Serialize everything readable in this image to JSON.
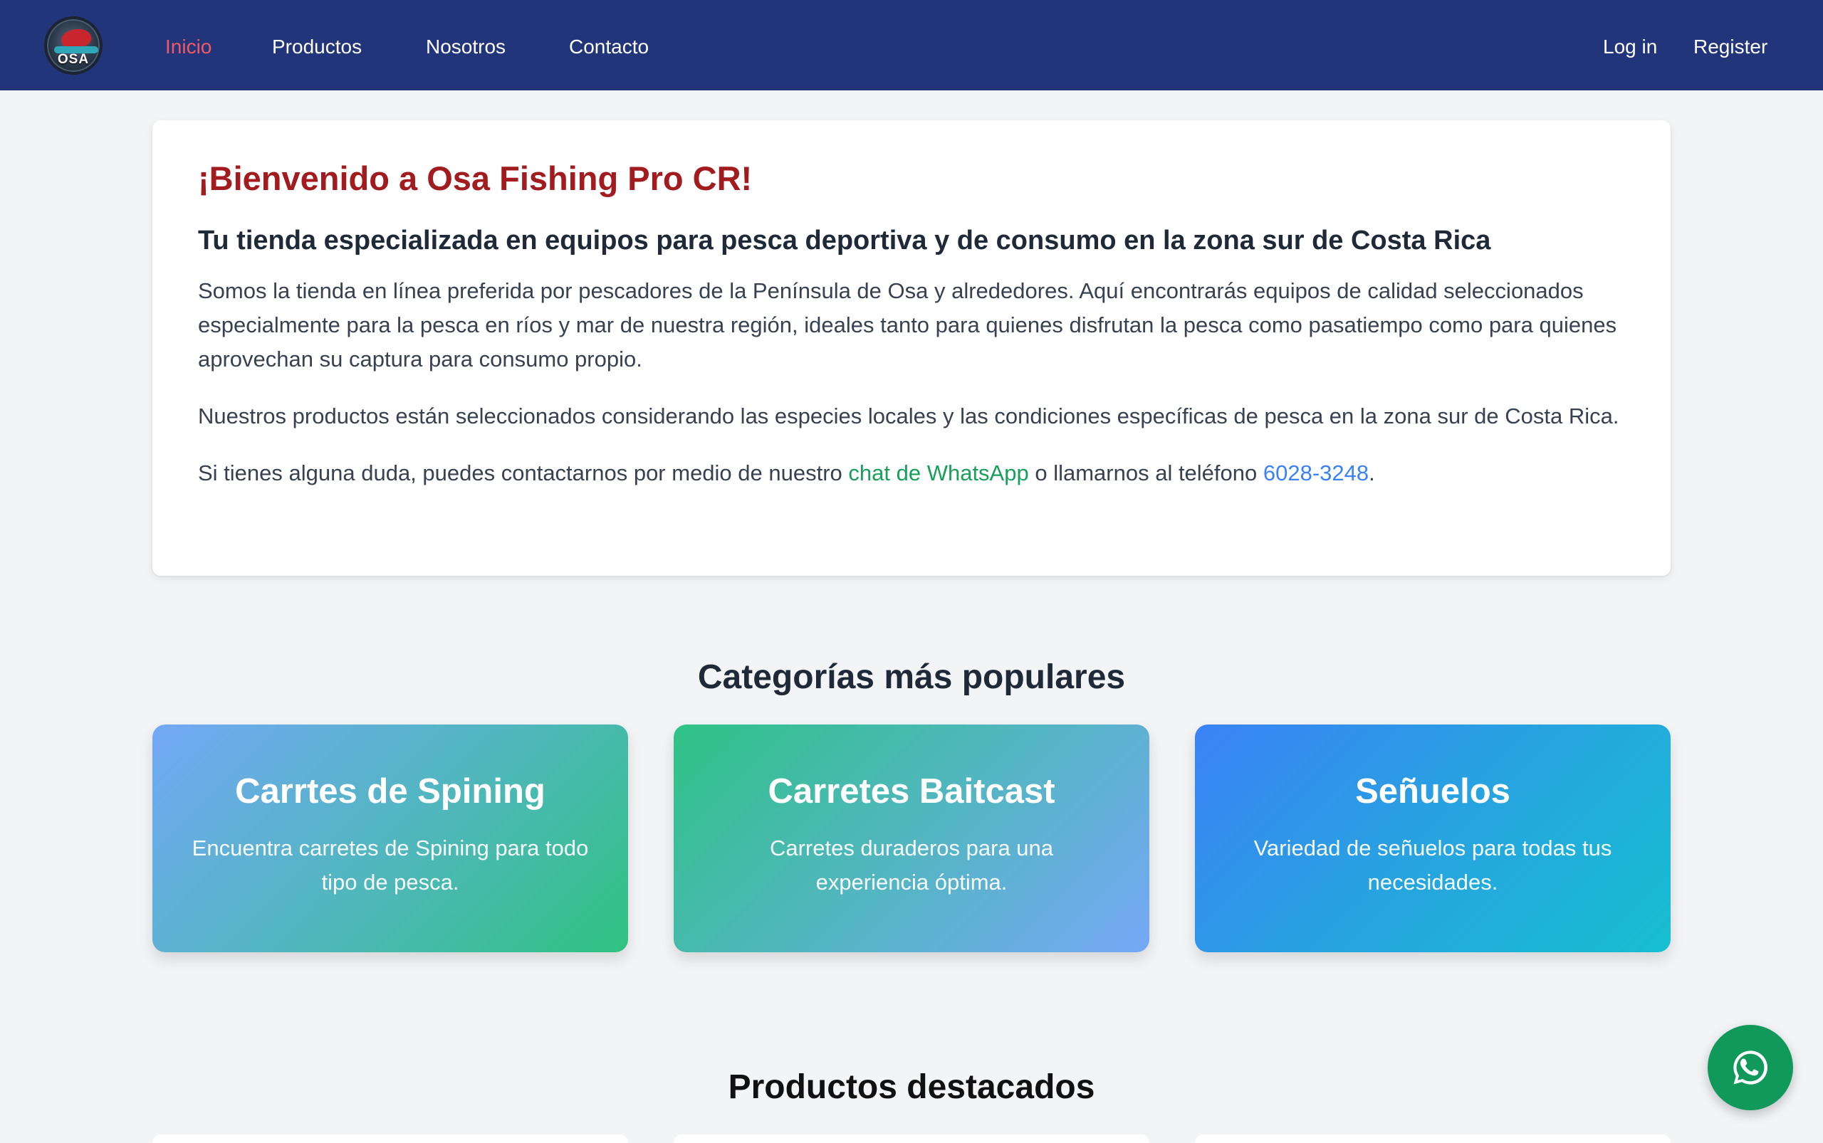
{
  "nav": {
    "logo_text": "OSA",
    "links": [
      {
        "label": "Inicio",
        "active": true
      },
      {
        "label": "Productos"
      },
      {
        "label": "Nosotros"
      },
      {
        "label": "Contacto"
      }
    ],
    "login_label": "Log in",
    "register_label": "Register"
  },
  "hero": {
    "title": "¡Bienvenido a Osa Fishing Pro CR!",
    "subtitle": "Tu tienda especializada en equipos para pesca deportiva y de consumo en la zona sur de Costa Rica",
    "paragraph1": "Somos la tienda en línea preferida por pescadores de la Península de Osa y alrededores. Aquí encontrarás equipos de calidad seleccionados especialmente para la pesca en ríos y mar de nuestra región, ideales tanto para quienes disfrutan la pesca como pasatiempo como para quienes aprovechan su captura para consumo propio.",
    "paragraph2": "Nuestros productos están seleccionados considerando las especies locales y las condiciones específicas de pesca en la zona sur de Costa Rica.",
    "contact_prefix": "Si tienes alguna duda, puedes contactarnos por medio de nuestro ",
    "whatsapp_link": "chat de WhatsApp",
    "contact_middle": " o llamarnos al teléfono ",
    "phone": "6028-3248",
    "contact_suffix": "."
  },
  "categories": {
    "title": "Categorías más populares",
    "items": [
      {
        "name": "Carrtes de Spining",
        "description": "Encuentra carretes de Spining para todo tipo de pesca."
      },
      {
        "name": "Carretes Baitcast",
        "description": "Carretes duraderos para una experiencia óptima."
      },
      {
        "name": "Señuelos",
        "description": "Variedad de señuelos para todas tus necesidades."
      }
    ]
  },
  "featured": {
    "title": "Productos destacados"
  },
  "colors": {
    "nav_bg": "#22357a",
    "active_link": "#f05a64",
    "hero_title": "#a11b1f",
    "whatsapp": "#10995a"
  },
  "icons": {
    "whatsapp": "whatsapp-icon"
  }
}
